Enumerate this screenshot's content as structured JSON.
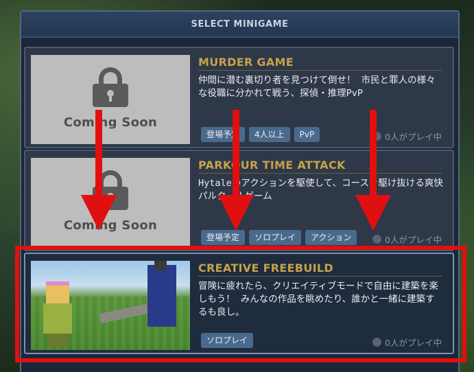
{
  "header": {
    "title": "SELECT MINIGAME"
  },
  "games": [
    {
      "title": "MURDER GAME",
      "description": "仲間に潜む裏切り者を見つけて倒せ！ 市民と罪人の様々な役職に分かれて戦う、探偵・推理PvP",
      "locked": true,
      "thumb_label": "Coming Soon",
      "tags": [
        "登場予定",
        "4人以上",
        "PvP"
      ],
      "players": "0人がプレイ中"
    },
    {
      "title": "PARKOUR TIME ATTACK",
      "description": "Hytaleのアクションを駆使して、コースを駆け抜ける爽快パルクールゲーム",
      "locked": true,
      "thumb_label": "Coming Soon",
      "tags": [
        "登場予定",
        "ソロプレイ",
        "アクション"
      ],
      "players": "0人がプレイ中"
    },
    {
      "title": "CREATIVE FREEBUILD",
      "description": "冒険に疲れたら、クリエイティブモードで自由に建築を楽しもう！ みんなの作品を眺めたり、誰かと一緒に建築するも良し。",
      "locked": false,
      "tags": [
        "ソロプレイ"
      ],
      "players": "0人がプレイ中"
    }
  ],
  "colors": {
    "annotation_red": "#e01010",
    "title_gold": "#c8a24a",
    "tag_blue": "#4a6a8c",
    "panel_bg": "#1b2738"
  }
}
